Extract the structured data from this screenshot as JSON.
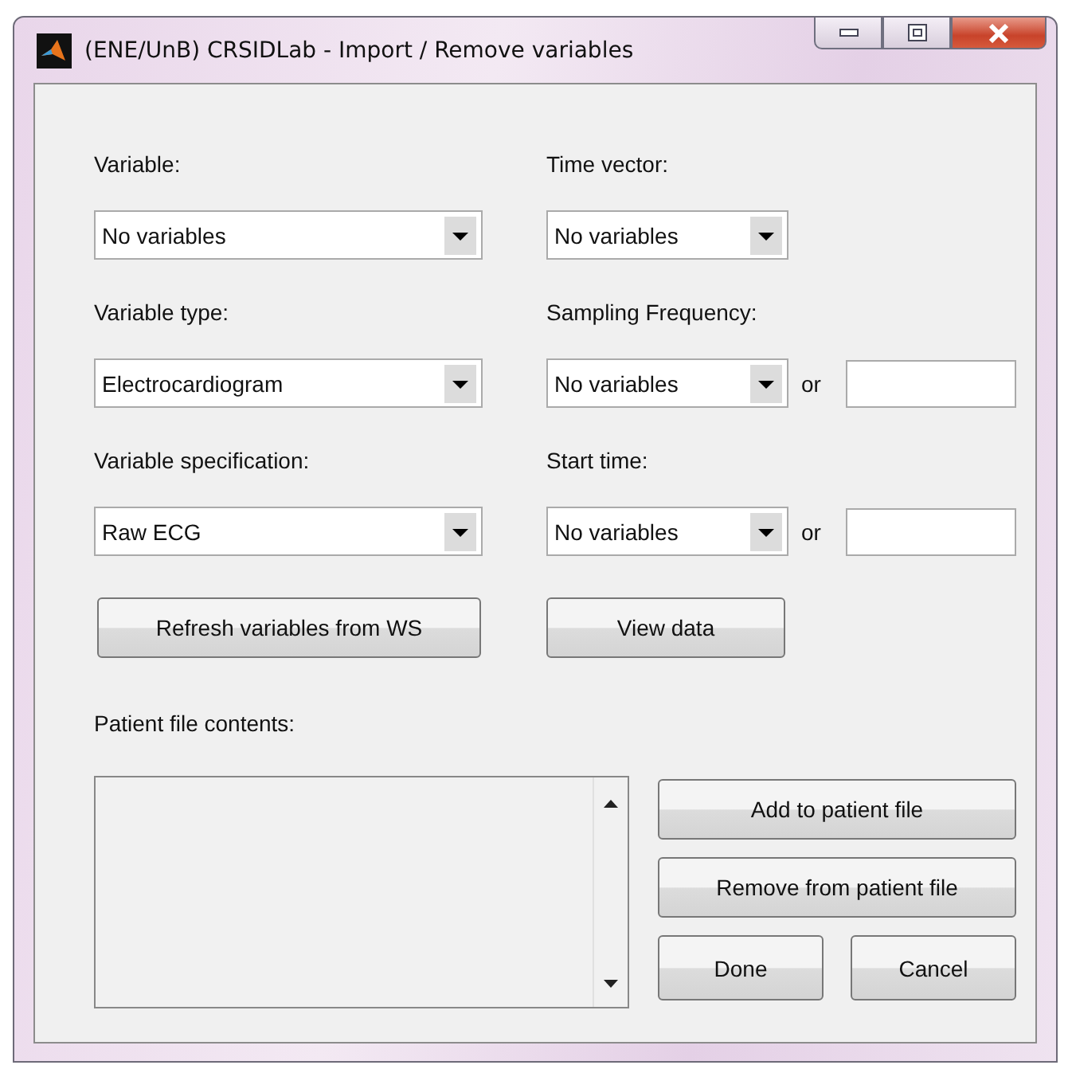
{
  "window": {
    "title": "(ENE/UnB) CRSIDLab - Import / Remove variables"
  },
  "left": [
    {
      "label": "Variable:",
      "value": "No variables"
    },
    {
      "label": "Variable type:",
      "value": "Electrocardiogram"
    },
    {
      "label": "Variable specification:",
      "value": "Raw ECG"
    }
  ],
  "right": [
    {
      "label": "Time vector:",
      "value": "No variables"
    },
    {
      "label": "Sampling Frequency:",
      "value": "No variables",
      "or": "or"
    },
    {
      "label": "Start time:",
      "value": "No variables",
      "or": "or"
    }
  ],
  "buttons": [
    "Refresh variables from WS",
    "View data"
  ],
  "patient_file": {
    "label": "Patient file contents:"
  },
  "actions": [
    "Add to patient file",
    "Remove from patient file"
  ],
  "footer_buttons": [
    "Done",
    "Cancel"
  ]
}
